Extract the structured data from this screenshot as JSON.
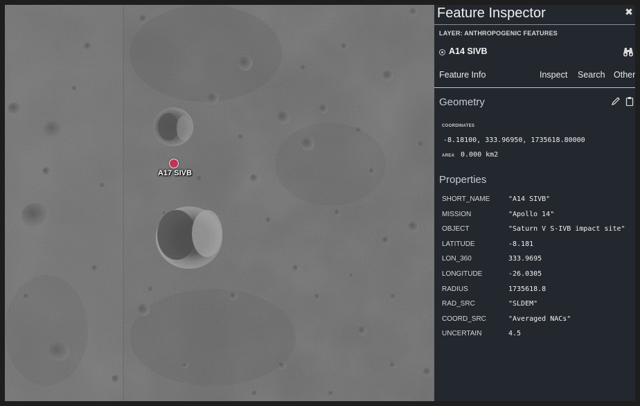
{
  "map": {
    "marker_label": "A17 SIVB"
  },
  "inspector": {
    "title": "Feature Inspector",
    "layer_line": "LAYER: ANTHROPOGENIC FEATURES",
    "feature_name": "A14 SIVB",
    "tabs": {
      "feature_info": "Feature Info",
      "inspect": "Inspect",
      "search": "Search",
      "other": "Other"
    },
    "geometry": {
      "heading": "Geometry",
      "coordinates_label": "COORDINATES",
      "coordinates_value": "-8.18100, 333.96950, 1735618.80000",
      "area_label": "AREA",
      "area_value": "0.000 km2"
    },
    "properties": {
      "heading": "Properties",
      "rows": [
        {
          "key": "SHORT_NAME",
          "value": "\"A14 SIVB\""
        },
        {
          "key": "MISSION",
          "value": "\"Apollo 14\""
        },
        {
          "key": "OBJECT",
          "value": "\"Saturn V S-IVB impact site\""
        },
        {
          "key": "LATITUDE",
          "value": "-8.181"
        },
        {
          "key": "LON_360",
          "value": "333.9695"
        },
        {
          "key": "LONGITUDE",
          "value": "-26.0305"
        },
        {
          "key": "RADIUS",
          "value": "1735618.8"
        },
        {
          "key": "RAD_SRC",
          "value": "\"SLDEM\""
        },
        {
          "key": "COORD_SRC",
          "value": "\"Averaged NACs\""
        },
        {
          "key": "UNCERTAIN",
          "value": "4.5"
        }
      ]
    }
  },
  "icons": {
    "close": "close-icon",
    "feature": "target-icon",
    "locate": "binoculars-icon",
    "edit": "pencil-icon",
    "copy": "clipboard-icon"
  },
  "colors": {
    "panel_bg": "#23272e",
    "marker": "#c0325a",
    "map_base": "#6b6b6b"
  }
}
